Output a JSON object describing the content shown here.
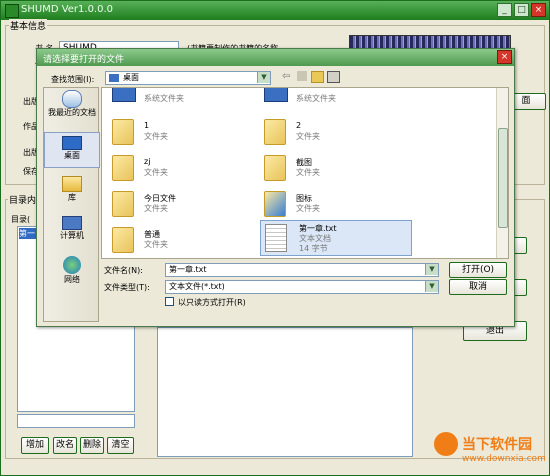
{
  "main_window": {
    "title": "SHUMD Ver1.0.0.0",
    "group_basic": "基本信息",
    "book_label": "书  名",
    "book_value": "SHUMD",
    "author_label": "作",
    "hint_text": "(书籍要制作的书籍的名称",
    "publisher_label": "出版",
    "works_label": "作品",
    "publish_date_label": "出版",
    "save_label": "保存",
    "group_toc": "目录内容",
    "toc_label": "目录(",
    "toc_selected": "第一",
    "btn_add": "增加",
    "btn_rename": "改名",
    "btn_delete": "删除",
    "btn_clear": "清空",
    "btn_right_partial": "面",
    "btn_exit": "退出"
  },
  "dialog": {
    "title": "请选择要打开的文件",
    "look_in_label": "查找范围(I):",
    "look_in_value": "桌面",
    "places": [
      {
        "label": "我最近的文档"
      },
      {
        "label": "桌面"
      },
      {
        "label": "库"
      },
      {
        "label": "计算机"
      },
      {
        "label": "网络"
      }
    ],
    "files": [
      {
        "name": "",
        "type": "系统文件夹",
        "size": ""
      },
      {
        "name": "",
        "type": "系统文件夹",
        "size": ""
      },
      {
        "name": "1",
        "type": "文件夹",
        "size": ""
      },
      {
        "name": "2",
        "type": "文件夹",
        "size": ""
      },
      {
        "name": "zj",
        "type": "文件夹",
        "size": ""
      },
      {
        "name": "截图",
        "type": "文件夹",
        "size": ""
      },
      {
        "name": "今日文件",
        "type": "文件夹",
        "size": ""
      },
      {
        "name": "图标",
        "type": "文件夹",
        "size": ""
      },
      {
        "name": "普通",
        "type": "文件夹",
        "size": ""
      },
      {
        "name": "第一章.txt",
        "type": "文本文档",
        "size": "14 字节"
      }
    ],
    "filename_label": "文件名(N):",
    "filename_value": "第一章.txt",
    "filetype_label": "文件类型(T):",
    "filetype_value": "文本文件(*.txt)",
    "readonly_label": "以只读方式打开(R)",
    "open_button": "打开(O)",
    "cancel_button": "取消"
  },
  "watermark": {
    "brand": "当下软件园",
    "url": "www.downxia.com"
  },
  "colors": {
    "title_green": "#1e7d1e",
    "dialog_title": "#4f9a4f",
    "watermark_orange": "#f07d16"
  }
}
